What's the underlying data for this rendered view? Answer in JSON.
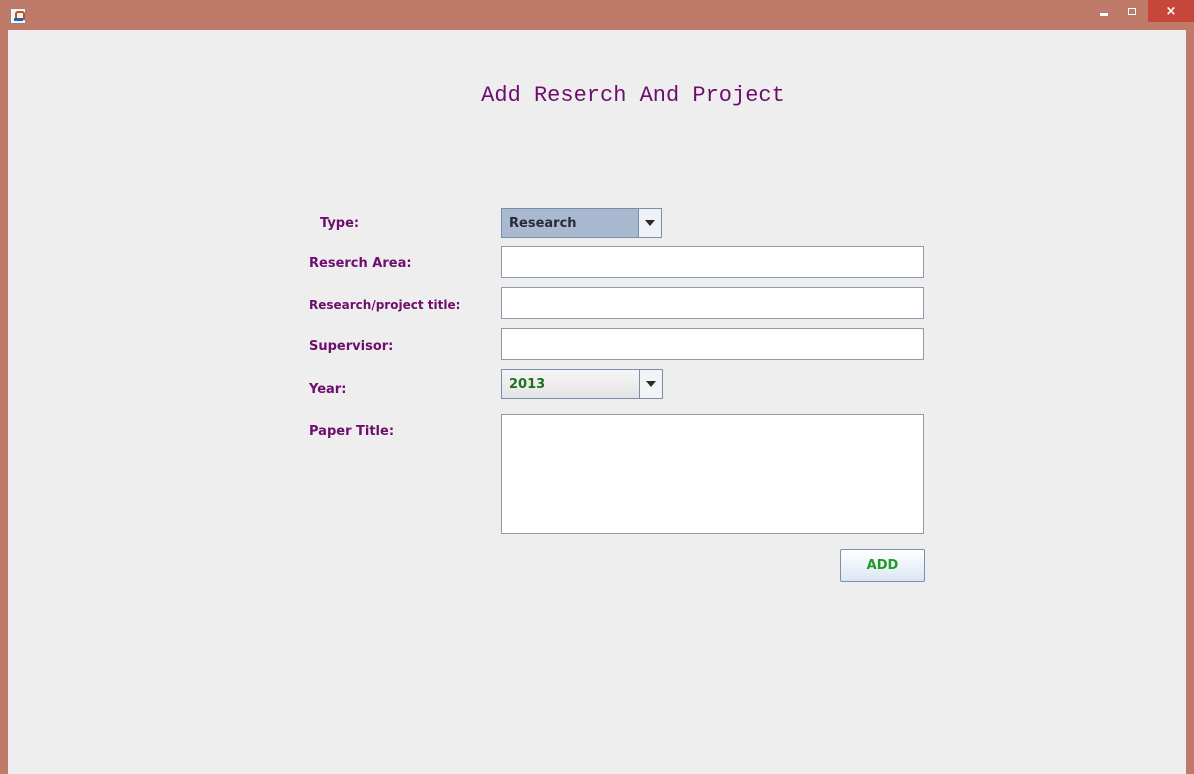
{
  "window": {
    "controls": {
      "close_glyph": "×"
    }
  },
  "form": {
    "title": "Add Reserch And Project",
    "type": {
      "label": "Type:",
      "selected": "Research"
    },
    "research_area": {
      "label": "Reserch Area:",
      "value": ""
    },
    "project_title": {
      "label": "Research/project title:",
      "value": ""
    },
    "supervisor": {
      "label": "Supervisor:",
      "value": ""
    },
    "year": {
      "label": "Year:",
      "selected": "2013"
    },
    "paper_title": {
      "label": "Paper Title:",
      "value": ""
    },
    "add_label": "ADD"
  },
  "colors": {
    "label": "#6e0d6e",
    "year_value": "#1f6f1f",
    "add_text": "#229a2a",
    "type_combo_bg": "#a9bad0",
    "titlebar": "#c07a6a"
  },
  "icons": {
    "app": "java-app-icon",
    "minimize": "minimize-icon",
    "maximize": "maximize-icon",
    "close": "close-icon",
    "dropdown": "chevron-down-icon"
  }
}
